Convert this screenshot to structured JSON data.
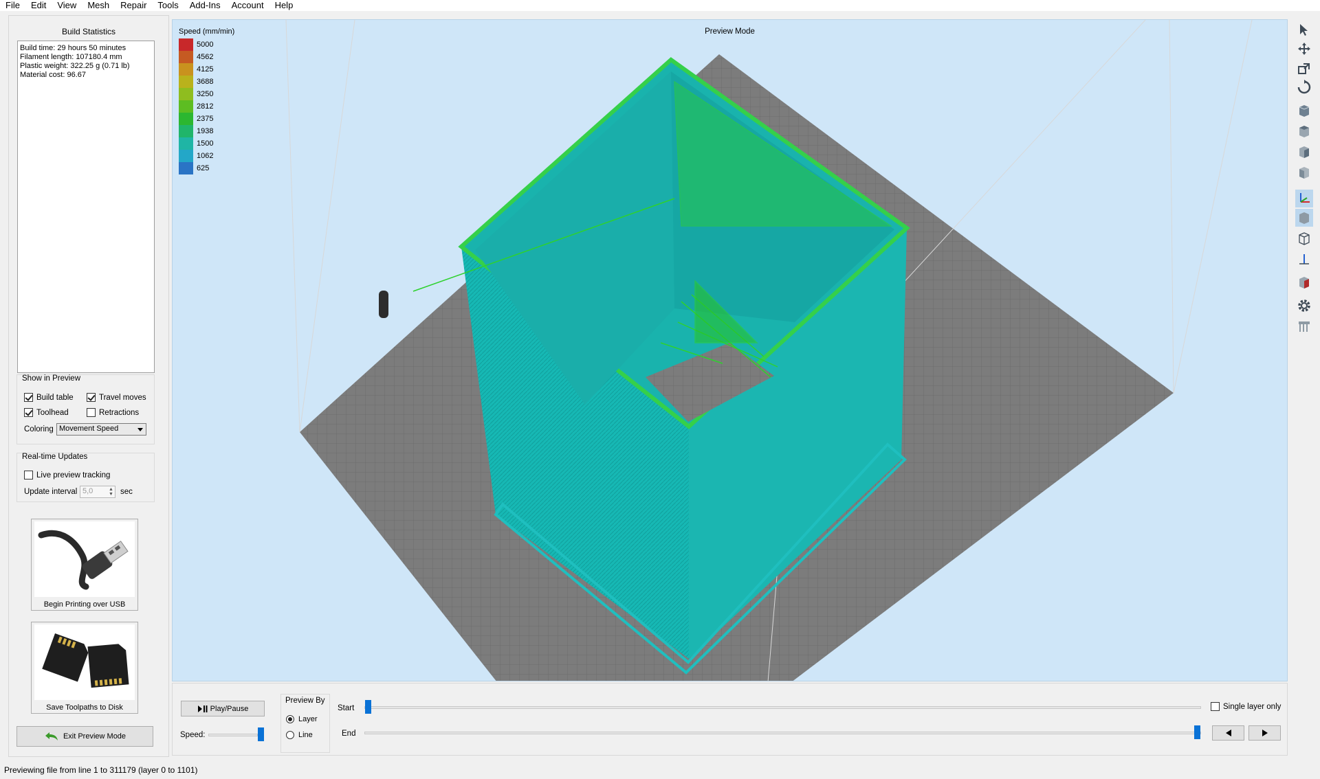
{
  "menu": [
    "File",
    "Edit",
    "View",
    "Mesh",
    "Repair",
    "Tools",
    "Add-Ins",
    "Account",
    "Help"
  ],
  "build_stats": {
    "title": "Build Statistics",
    "lines": [
      "Build time: 29 hours 50 minutes",
      "Filament length: 107180.4 mm",
      "Plastic weight: 322.25 g (0.71 lb)",
      "Material cost: 96.67"
    ]
  },
  "show_in_preview": {
    "title": "Show in Preview",
    "build_table": {
      "label": "Build table",
      "checked": true
    },
    "travel_moves": {
      "label": "Travel moves",
      "checked": true
    },
    "toolhead": {
      "label": "Toolhead",
      "checked": true
    },
    "retractions": {
      "label": "Retractions",
      "checked": false
    },
    "coloring_label": "Coloring",
    "coloring_value": "Movement Speed"
  },
  "realtime": {
    "title": "Real-time Updates",
    "live_label": "Live preview tracking",
    "live_checked": false,
    "interval_label": "Update interval",
    "interval_value": "5,0",
    "interval_unit": "sec"
  },
  "actions": {
    "usb_label": "Begin Printing over USB",
    "disk_label": "Save Toolpaths to Disk",
    "exit_label": "Exit Preview Mode"
  },
  "viewport": {
    "title": "Preview Mode",
    "legend_title": "Speed (mm/min)",
    "legend": [
      {
        "value": "5000",
        "color": "#c8282a"
      },
      {
        "value": "4562",
        "color": "#c55a22"
      },
      {
        "value": "4125",
        "color": "#c9921e"
      },
      {
        "value": "3688",
        "color": "#b9b21c"
      },
      {
        "value": "3250",
        "color": "#8fbd1f"
      },
      {
        "value": "2812",
        "color": "#5dbd22"
      },
      {
        "value": "2375",
        "color": "#2cb730"
      },
      {
        "value": "1938",
        "color": "#20b56a"
      },
      {
        "value": "1500",
        "color": "#1fb5a5"
      },
      {
        "value": "1062",
        "color": "#23a7c8"
      },
      {
        "value": "625",
        "color": "#2a74c5"
      }
    ]
  },
  "playback": {
    "play_label": "Play/Pause",
    "speed_label": "Speed:",
    "preview_by_title": "Preview By",
    "layer_label": "Layer",
    "line_label": "Line",
    "preview_by_value": "Layer",
    "start_label": "Start",
    "end_label": "End",
    "single_layer_label": "Single layer only",
    "single_layer_checked": false
  },
  "status": "Previewing file from line 1 to 311179 (layer 0 to 1101)"
}
